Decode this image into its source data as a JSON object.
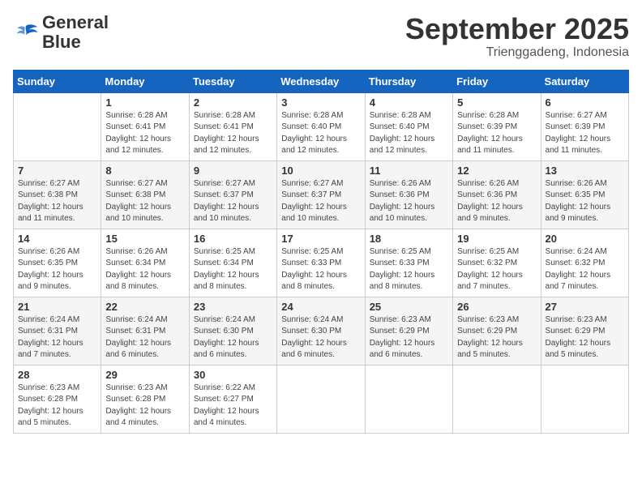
{
  "header": {
    "logo_general": "General",
    "logo_blue": "Blue",
    "month_title": "September 2025",
    "subtitle": "Trienggadeng, Indonesia"
  },
  "days_of_week": [
    "Sunday",
    "Monday",
    "Tuesday",
    "Wednesday",
    "Thursday",
    "Friday",
    "Saturday"
  ],
  "weeks": [
    [
      {
        "day": "",
        "sunrise": "",
        "sunset": "",
        "daylight": ""
      },
      {
        "day": "1",
        "sunrise": "6:28 AM",
        "sunset": "6:41 PM",
        "daylight": "12 hours and 12 minutes."
      },
      {
        "day": "2",
        "sunrise": "6:28 AM",
        "sunset": "6:41 PM",
        "daylight": "12 hours and 12 minutes."
      },
      {
        "day": "3",
        "sunrise": "6:28 AM",
        "sunset": "6:40 PM",
        "daylight": "12 hours and 12 minutes."
      },
      {
        "day": "4",
        "sunrise": "6:28 AM",
        "sunset": "6:40 PM",
        "daylight": "12 hours and 12 minutes."
      },
      {
        "day": "5",
        "sunrise": "6:28 AM",
        "sunset": "6:39 PM",
        "daylight": "12 hours and 11 minutes."
      },
      {
        "day": "6",
        "sunrise": "6:27 AM",
        "sunset": "6:39 PM",
        "daylight": "12 hours and 11 minutes."
      }
    ],
    [
      {
        "day": "7",
        "sunrise": "6:27 AM",
        "sunset": "6:38 PM",
        "daylight": "12 hours and 11 minutes."
      },
      {
        "day": "8",
        "sunrise": "6:27 AM",
        "sunset": "6:38 PM",
        "daylight": "12 hours and 10 minutes."
      },
      {
        "day": "9",
        "sunrise": "6:27 AM",
        "sunset": "6:37 PM",
        "daylight": "12 hours and 10 minutes."
      },
      {
        "day": "10",
        "sunrise": "6:27 AM",
        "sunset": "6:37 PM",
        "daylight": "12 hours and 10 minutes."
      },
      {
        "day": "11",
        "sunrise": "6:26 AM",
        "sunset": "6:36 PM",
        "daylight": "12 hours and 10 minutes."
      },
      {
        "day": "12",
        "sunrise": "6:26 AM",
        "sunset": "6:36 PM",
        "daylight": "12 hours and 9 minutes."
      },
      {
        "day": "13",
        "sunrise": "6:26 AM",
        "sunset": "6:35 PM",
        "daylight": "12 hours and 9 minutes."
      }
    ],
    [
      {
        "day": "14",
        "sunrise": "6:26 AM",
        "sunset": "6:35 PM",
        "daylight": "12 hours and 9 minutes."
      },
      {
        "day": "15",
        "sunrise": "6:26 AM",
        "sunset": "6:34 PM",
        "daylight": "12 hours and 8 minutes."
      },
      {
        "day": "16",
        "sunrise": "6:25 AM",
        "sunset": "6:34 PM",
        "daylight": "12 hours and 8 minutes."
      },
      {
        "day": "17",
        "sunrise": "6:25 AM",
        "sunset": "6:33 PM",
        "daylight": "12 hours and 8 minutes."
      },
      {
        "day": "18",
        "sunrise": "6:25 AM",
        "sunset": "6:33 PM",
        "daylight": "12 hours and 8 minutes."
      },
      {
        "day": "19",
        "sunrise": "6:25 AM",
        "sunset": "6:32 PM",
        "daylight": "12 hours and 7 minutes."
      },
      {
        "day": "20",
        "sunrise": "6:24 AM",
        "sunset": "6:32 PM",
        "daylight": "12 hours and 7 minutes."
      }
    ],
    [
      {
        "day": "21",
        "sunrise": "6:24 AM",
        "sunset": "6:31 PM",
        "daylight": "12 hours and 7 minutes."
      },
      {
        "day": "22",
        "sunrise": "6:24 AM",
        "sunset": "6:31 PM",
        "daylight": "12 hours and 6 minutes."
      },
      {
        "day": "23",
        "sunrise": "6:24 AM",
        "sunset": "6:30 PM",
        "daylight": "12 hours and 6 minutes."
      },
      {
        "day": "24",
        "sunrise": "6:24 AM",
        "sunset": "6:30 PM",
        "daylight": "12 hours and 6 minutes."
      },
      {
        "day": "25",
        "sunrise": "6:23 AM",
        "sunset": "6:29 PM",
        "daylight": "12 hours and 6 minutes."
      },
      {
        "day": "26",
        "sunrise": "6:23 AM",
        "sunset": "6:29 PM",
        "daylight": "12 hours and 5 minutes."
      },
      {
        "day": "27",
        "sunrise": "6:23 AM",
        "sunset": "6:29 PM",
        "daylight": "12 hours and 5 minutes."
      }
    ],
    [
      {
        "day": "28",
        "sunrise": "6:23 AM",
        "sunset": "6:28 PM",
        "daylight": "12 hours and 5 minutes."
      },
      {
        "day": "29",
        "sunrise": "6:23 AM",
        "sunset": "6:28 PM",
        "daylight": "12 hours and 4 minutes."
      },
      {
        "day": "30",
        "sunrise": "6:22 AM",
        "sunset": "6:27 PM",
        "daylight": "12 hours and 4 minutes."
      },
      {
        "day": "",
        "sunrise": "",
        "sunset": "",
        "daylight": ""
      },
      {
        "day": "",
        "sunrise": "",
        "sunset": "",
        "daylight": ""
      },
      {
        "day": "",
        "sunrise": "",
        "sunset": "",
        "daylight": ""
      },
      {
        "day": "",
        "sunrise": "",
        "sunset": "",
        "daylight": ""
      }
    ]
  ]
}
